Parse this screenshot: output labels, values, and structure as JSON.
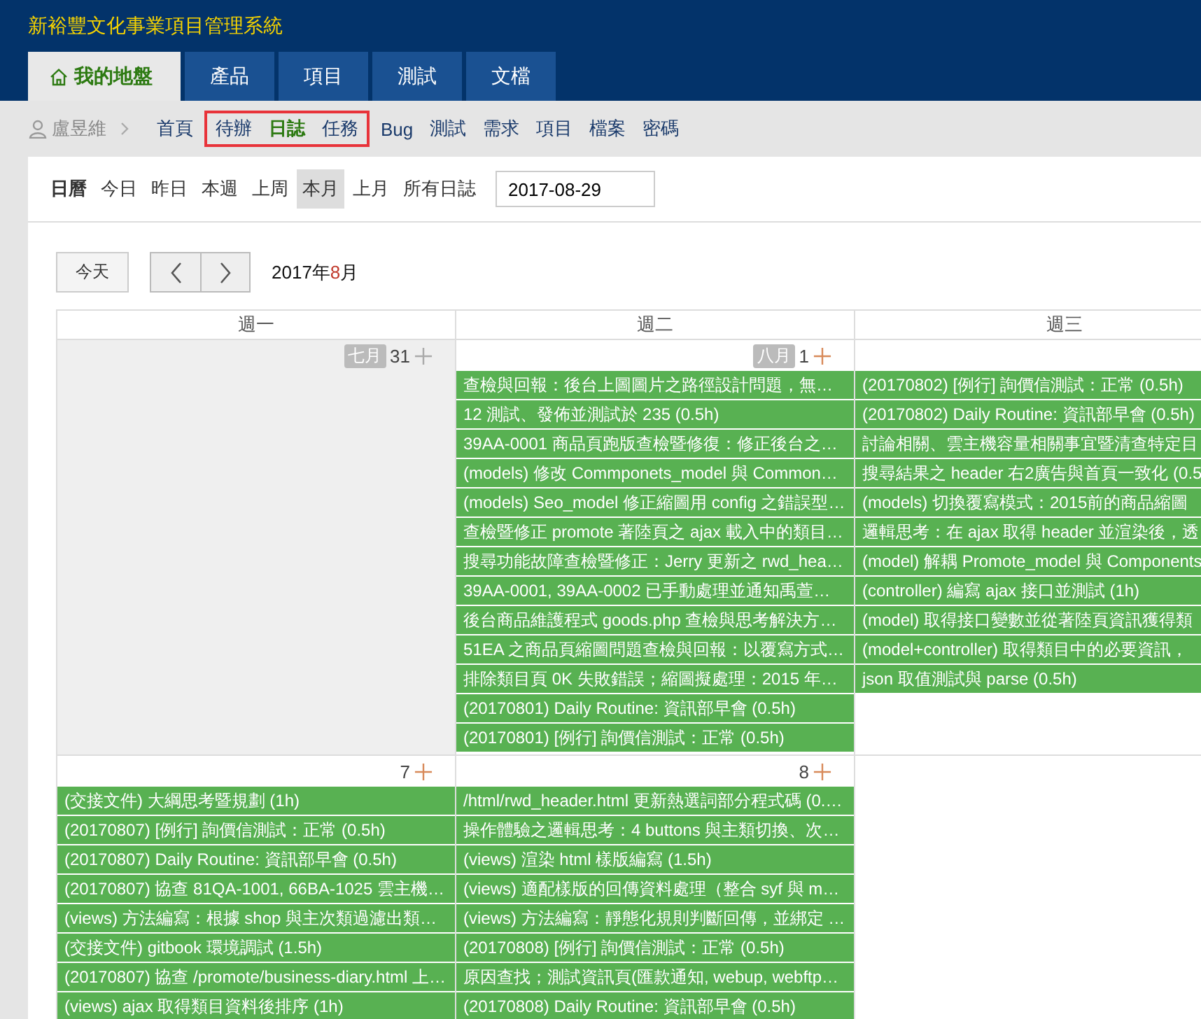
{
  "app_title": "新裕豐文化事業項目管理系統",
  "tabs": [
    {
      "label": "我的地盤",
      "selected": true
    },
    {
      "label": "產品",
      "selected": false
    },
    {
      "label": "項目",
      "selected": false
    },
    {
      "label": "測試",
      "selected": false
    },
    {
      "label": "文檔",
      "selected": false
    }
  ],
  "subnav": {
    "user": "盧昱維",
    "groups": [
      {
        "highlighted": false,
        "items": [
          {
            "label": "首頁",
            "selected": false
          }
        ]
      },
      {
        "highlighted": true,
        "items": [
          {
            "label": "待辦",
            "selected": false
          },
          {
            "label": "日誌",
            "selected": true
          },
          {
            "label": "任務",
            "selected": false
          }
        ]
      },
      {
        "highlighted": false,
        "items": [
          {
            "label": "Bug",
            "selected": false
          },
          {
            "label": "測試",
            "selected": false
          },
          {
            "label": "需求",
            "selected": false
          },
          {
            "label": "項目",
            "selected": false
          },
          {
            "label": "檔案",
            "selected": false
          },
          {
            "label": "密碼",
            "selected": false
          }
        ]
      }
    ]
  },
  "filters": {
    "title": "日曆",
    "items": [
      {
        "label": "今日",
        "selected": false
      },
      {
        "label": "昨日",
        "selected": false
      },
      {
        "label": "本週",
        "selected": false
      },
      {
        "label": "上周",
        "selected": false
      },
      {
        "label": "本月",
        "selected": true
      },
      {
        "label": "上月",
        "selected": false
      },
      {
        "label": "所有日誌",
        "selected": false
      }
    ],
    "date": "2017-08-29"
  },
  "calendar": {
    "today_button": "今天",
    "title_year": "2017年",
    "title_month": "8",
    "title_suffix": "月",
    "columns": [
      "週一",
      "週二",
      "週三"
    ],
    "weeks": [
      {
        "days": [
          {
            "month_label": "七月",
            "day": "31",
            "other_month": true
          },
          {
            "month_label": "八月",
            "day": "1",
            "other_month": false,
            "events": [
              "查檢與回報：後台上圖圖片之路徑設計問題，無…",
              "12 測試、發佈並測試於 235 (0.5h)",
              "39AA-0001 商品頁跑版查檢暨修復：修正後台之…",
              "(models) 修改 Commponets_model 與 Common…",
              "(models) Seo_model 修正縮圖用 config 之錯誤型…",
              "查檢暨修正 promote 著陸頁之 ajax 載入中的類目…",
              "搜尋功能故障查檢暨修正：Jerry 更新之 rwd_hea…",
              "39AA-0001, 39AA-0002 已手動處理並通知禹萱…",
              "後台商品維護程式 goods.php 查檢與思考解決方…",
              "51EA 之商品頁縮圖問題查檢與回報：以覆寫方式…",
              "排除類目頁 0K 失敗錯誤；縮圖擬處理：2015 年…",
              "(20170801) Daily Routine: 資訊部早會 (0.5h)",
              "(20170801) [例行] 詢價信測試：正常 (0.5h)"
            ]
          },
          {
            "other_month": false,
            "events": [
              "(20170802) [例行] 詢價信測試：正常 (0.5h)",
              "(20170802) Daily Routine: 資訊部早會 (0.5h)",
              "討論相關、雲主機容量相關事宜暨清查特定目",
              "搜尋結果之 header 右2廣告與首頁一致化 (0.5",
              "(models) 切換覆寫模式：2015前的商品縮圖",
              "邏輯思考：在 ajax 取得 header 並渲染後，透",
              "(model) 解耦 Promote_model 與 Components",
              "(controller) 編寫 ajax 接口並測試 (1h)",
              "(model) 取得接口變數並從著陸頁資訊獲得類",
              "(model+controller) 取得類目中的必要資訊，",
              "json 取值測試與 parse (0.5h)"
            ]
          }
        ]
      },
      {
        "days": [
          {
            "day": "7",
            "other_month": false,
            "events": [
              "(交接文件) 大綱思考暨規劃 (1h)",
              "(20170807) [例行] 詢價信測試：正常 (0.5h)",
              "(20170807) Daily Routine: 資訊部早會 (0.5h)",
              "(20170807) 協查 81QA-1001, 66BA-1025 雲主機…",
              "(views) 方法編寫：根據 shop 與主次類過濾出類…",
              "(交接文件) gitbook 環境調試 (1.5h)",
              "(20170807) 協查 /promote/business-diary.html 上…",
              "(views) ajax 取得類目資料後排序 (1h)"
            ]
          },
          {
            "day": "8",
            "other_month": false,
            "events": [
              "/html/rwd_header.html 更新熱選詞部分程式碼 (0.…",
              "操作體驗之邏輯思考：4 buttons 與主類切換、次…",
              "(views) 渲染 html 樣版編寫 (1.5h)",
              "(views) 適配樣版的回傳資料處理（整合 syf 與 m…",
              "(views) 方法編寫：靜態化規則判斷回傳，並綁定 …",
              "(20170808) [例行] 詢價信測試：正常 (0.5h)",
              "原因查找；測試資訊頁(匯款通知, webup, webftp…",
              "(20170808) Daily Routine: 資訊部早會 (0.5h)"
            ]
          },
          {
            "other_month": false
          }
        ]
      }
    ]
  }
}
